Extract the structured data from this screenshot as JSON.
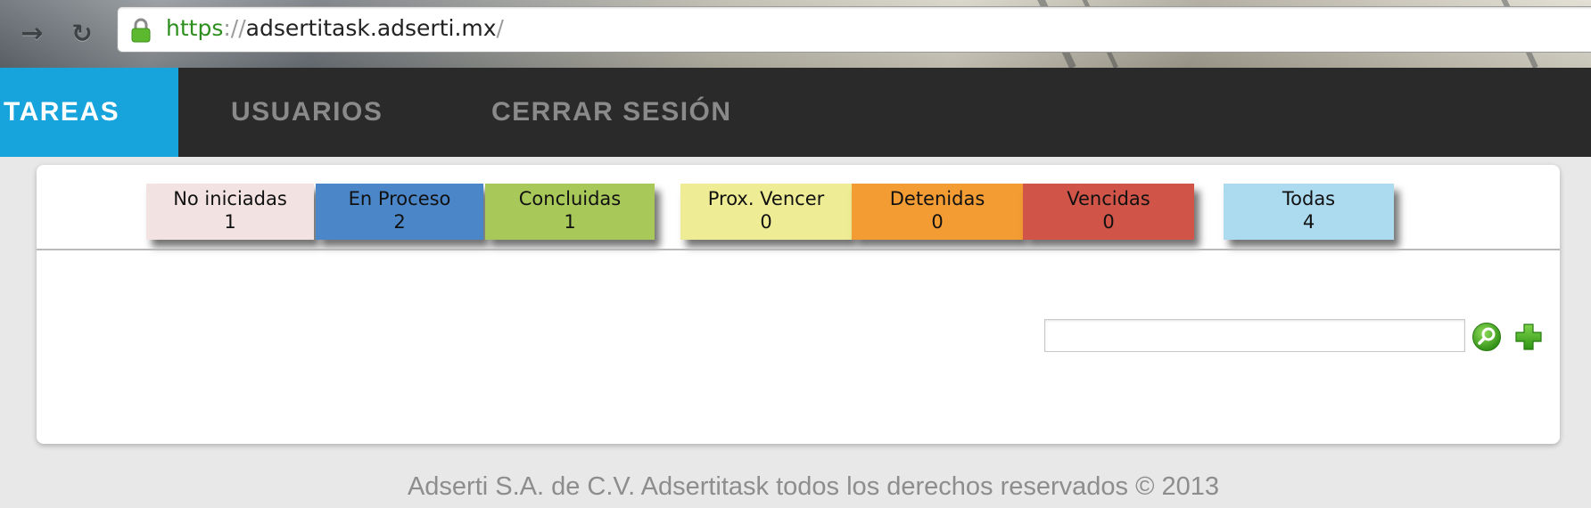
{
  "browser": {
    "url_scheme": "https",
    "url_separator": "://",
    "url_host": "adsertitask.adserti.mx",
    "url_path": "/",
    "back_icon": "back-arrow-icon",
    "reload_icon": "reload-icon",
    "lock_icon": "lock-icon",
    "lock_color": "#5cb82e"
  },
  "nav": {
    "items": [
      {
        "label": "TAREAS",
        "active": true
      },
      {
        "label": "USUARIOS",
        "active": false
      },
      {
        "label": "CERRAR SESIÓN",
        "active": false
      }
    ],
    "active_color": "#17a4dc",
    "bar_color": "#2a2a2a"
  },
  "status_cards": [
    {
      "label": "No iniciadas",
      "count": "1",
      "color": "#f2e3e2"
    },
    {
      "label": "En Proceso",
      "count": "2",
      "color": "#4a86c8"
    },
    {
      "label": "Concluidas",
      "count": "1",
      "color": "#a8c95a"
    },
    {
      "label": "Prox. Vencer",
      "count": "0",
      "color": "#eeec94"
    },
    {
      "label": "Detenidas",
      "count": "0",
      "color": "#f39c34"
    },
    {
      "label": "Vencidas",
      "count": "0",
      "color": "#d05448"
    },
    {
      "label": "Todas",
      "count": "4",
      "color": "#acdaef"
    }
  ],
  "search": {
    "value": "",
    "placeholder": "",
    "search_icon": "search-icon",
    "add_icon": "plus-icon",
    "icon_color": "#3aa61c"
  },
  "footer": {
    "text": "Adserti S.A. de C.V. Adsertitask todos los derechos reservados © 2013"
  }
}
